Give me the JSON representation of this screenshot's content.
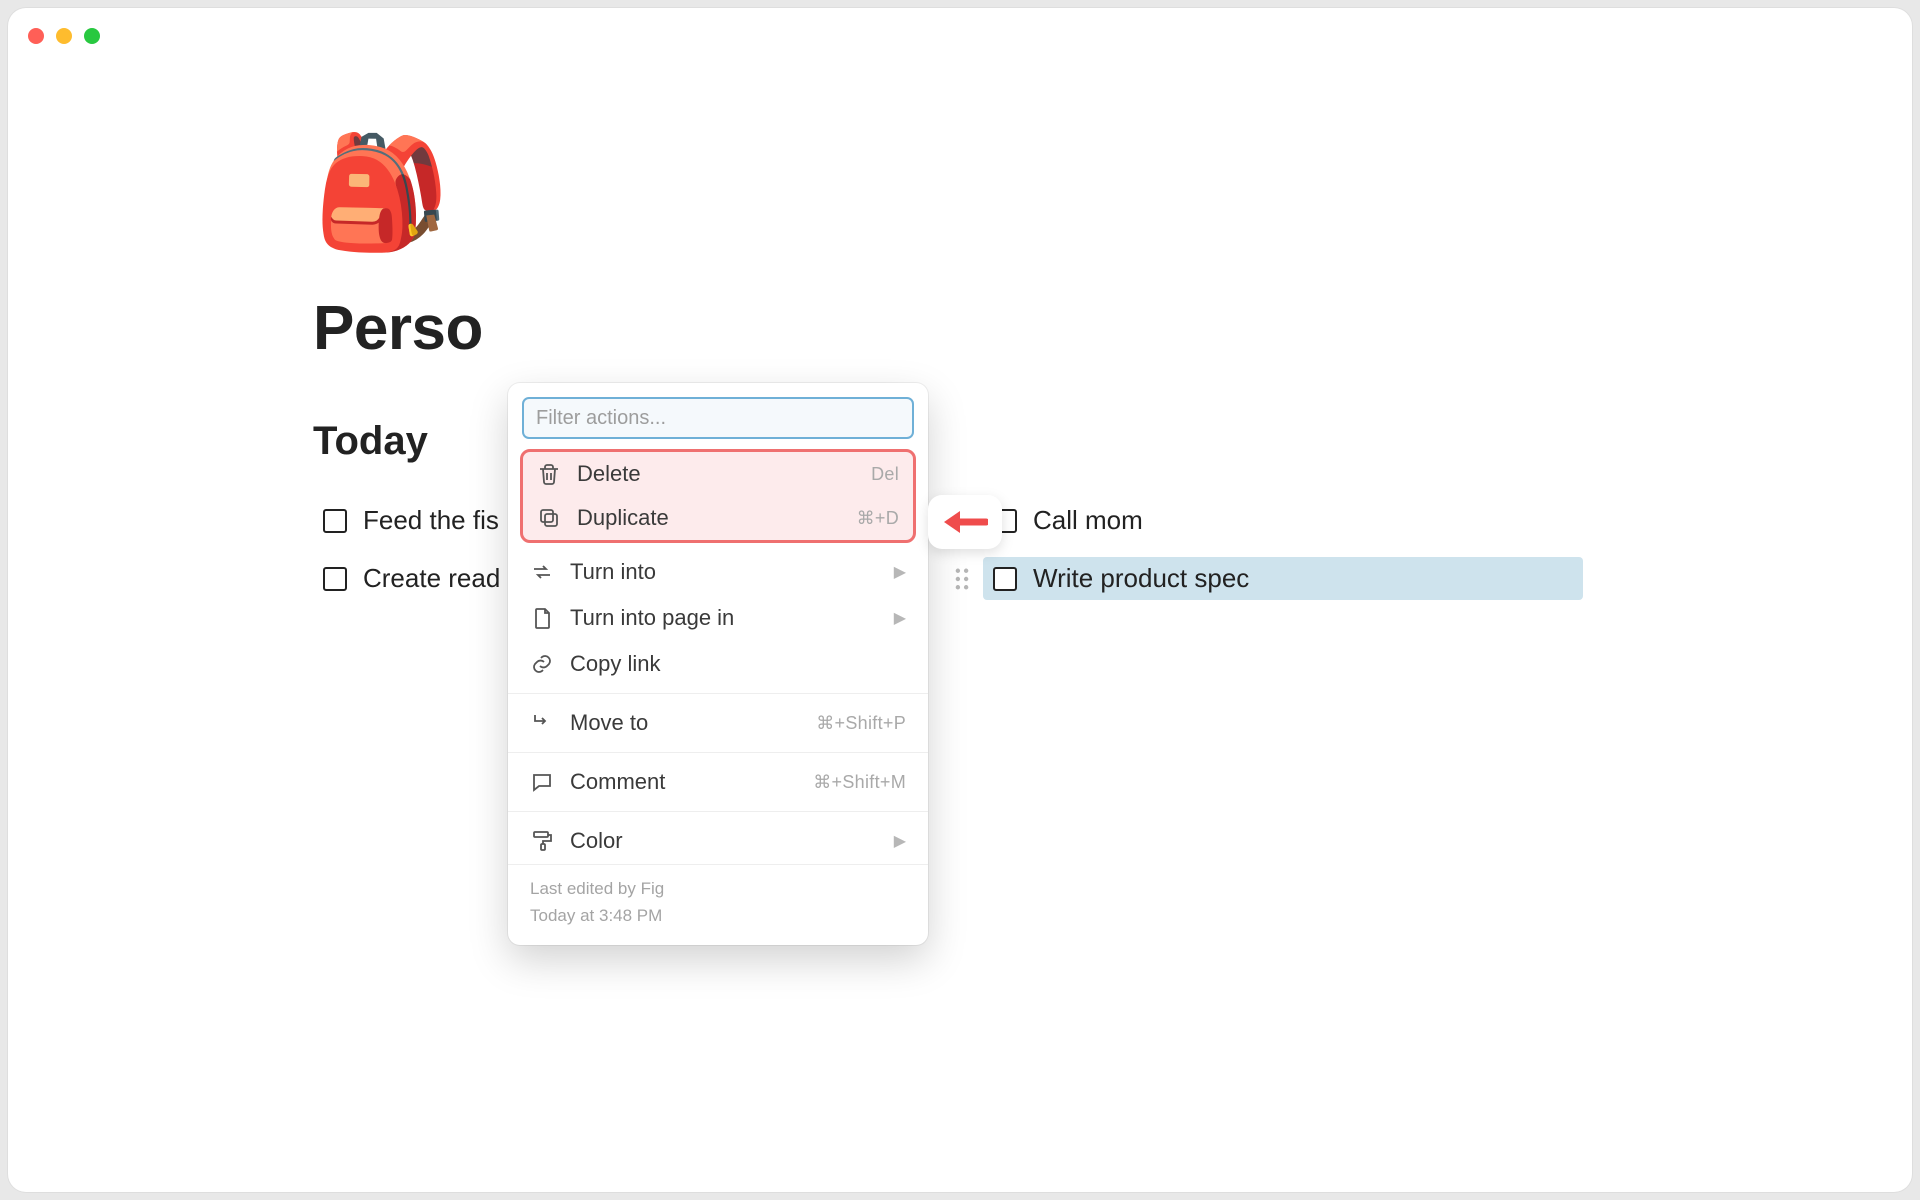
{
  "window": {
    "traffic_lights": [
      "red",
      "yellow",
      "green"
    ]
  },
  "page": {
    "emoji": "🎒",
    "title_visible": "Perso",
    "section": "Today",
    "tasks_col1": [
      "Feed the fis",
      "Create read"
    ],
    "tasks_col2": [
      "Call mom",
      "Write product spec"
    ],
    "selected_task_index_col2": 1
  },
  "popover": {
    "filter_placeholder": "Filter actions...",
    "highlight_items": [
      {
        "id": "delete",
        "label": "Delete",
        "kbd": "Del",
        "icon": "trash"
      },
      {
        "id": "duplicate",
        "label": "Duplicate",
        "kbd": "⌘+D",
        "icon": "duplicate"
      }
    ],
    "items_group1": [
      {
        "id": "turn-into",
        "label": "Turn into",
        "submenu": true,
        "icon": "swap"
      },
      {
        "id": "turn-into-page-in",
        "label": "Turn into page in",
        "submenu": true,
        "icon": "page"
      },
      {
        "id": "copy-link",
        "label": "Copy link",
        "icon": "link"
      }
    ],
    "items_group2": [
      {
        "id": "move-to",
        "label": "Move to",
        "kbd": "⌘+Shift+P",
        "icon": "arrow-right"
      }
    ],
    "items_group3": [
      {
        "id": "comment",
        "label": "Comment",
        "kbd": "⌘+Shift+M",
        "icon": "comment"
      }
    ],
    "items_group4": [
      {
        "id": "color",
        "label": "Color",
        "submenu": true,
        "icon": "paint"
      }
    ],
    "footer_line1": "Last edited by Fig",
    "footer_line2": "Today at 3:48 PM"
  }
}
